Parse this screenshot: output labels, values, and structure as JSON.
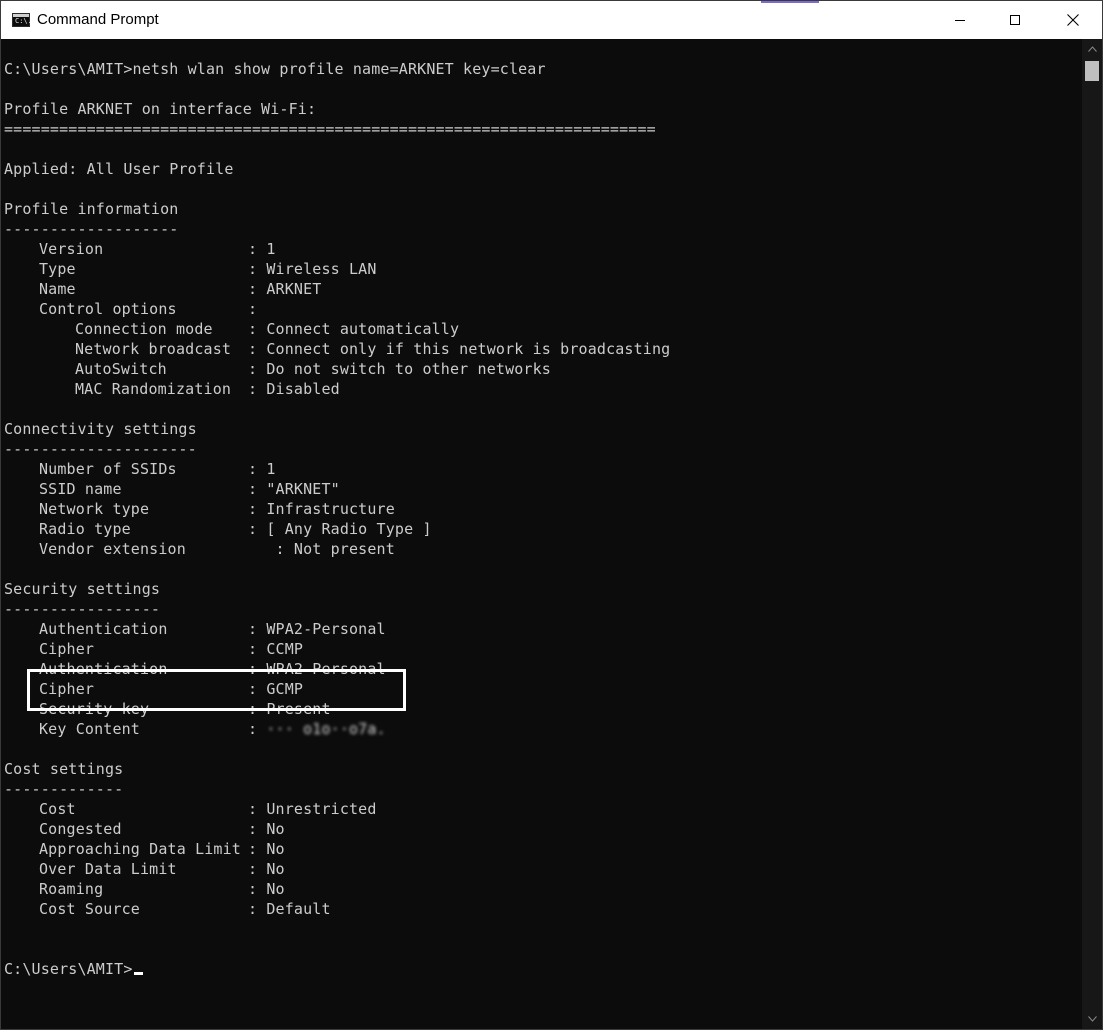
{
  "window": {
    "title": "Command Prompt",
    "icon_text": "C:\\."
  },
  "console": {
    "command_line": "C:\\Users\\AMIT>netsh wlan show profile name=ARKNET key=clear",
    "profile_header": "Profile ARKNET on interface Wi-Fi:",
    "separator": "=======================================================================",
    "applied": "Applied: All User Profile",
    "sections": {
      "profile_info": {
        "title": "Profile information",
        "underline": "-------------------",
        "rows": [
          {
            "label": "Version",
            "sep": ": ",
            "value": "1"
          },
          {
            "label": "Type",
            "sep": ": ",
            "value": "Wireless LAN"
          },
          {
            "label": "Name",
            "sep": ": ",
            "value": "ARKNET"
          },
          {
            "label": "Control options",
            "sep": ":",
            "value": ""
          },
          {
            "label": "Connection mode",
            "sep": ": ",
            "value": "Connect automatically"
          },
          {
            "label": "Network broadcast",
            "sep": ": ",
            "value": "Connect only if this network is broadcasting"
          },
          {
            "label": "AutoSwitch",
            "sep": ": ",
            "value": "Do not switch to other networks"
          },
          {
            "label": "MAC Randomization",
            "sep": ": ",
            "value": "Disabled"
          }
        ]
      },
      "connectivity": {
        "title": "Connectivity settings",
        "underline": "---------------------",
        "rows": [
          {
            "label": "Number of SSIDs",
            "sep": ": ",
            "value": "1"
          },
          {
            "label": "SSID name",
            "sep": ": ",
            "value": "\"ARKNET\""
          },
          {
            "label": "Network type",
            "sep": ": ",
            "value": "Infrastructure"
          },
          {
            "label": "Radio type",
            "sep": ": ",
            "value": "[ Any Radio Type ]"
          },
          {
            "label": "Vendor extension",
            "sep": "   : ",
            "value": "Not present"
          }
        ]
      },
      "security": {
        "title": "Security settings",
        "underline": "-----------------",
        "rows": [
          {
            "label": "Authentication",
            "sep": ": ",
            "value": "WPA2-Personal"
          },
          {
            "label": "Cipher",
            "sep": ": ",
            "value": "CCMP"
          },
          {
            "label": "Authentication",
            "sep": ": ",
            "value": "WPA2-Personal"
          },
          {
            "label": "Cipher",
            "sep": ": ",
            "value": "GCMP"
          },
          {
            "label": "Security key",
            "sep": ": ",
            "value": "Present"
          },
          {
            "label": "Key Content",
            "sep": ": ",
            "value": "··· o1o··o7a."
          }
        ]
      },
      "cost": {
        "title": "Cost settings",
        "underline": "-------------",
        "rows": [
          {
            "label": "Cost",
            "sep": ": ",
            "value": "Unrestricted"
          },
          {
            "label": "Congested",
            "sep": ": ",
            "value": "No"
          },
          {
            "label": "Approaching Data Limit",
            "sep": ": ",
            "value": "No"
          },
          {
            "label": "Over Data Limit",
            "sep": ": ",
            "value": "No"
          },
          {
            "label": "Roaming",
            "sep": ": ",
            "value": "No"
          },
          {
            "label": "Cost Source",
            "sep": ": ",
            "value": "Default"
          }
        ]
      }
    },
    "prompt": "C:\\Users\\AMIT>"
  },
  "colors": {
    "console_bg": "#0c0c0c",
    "console_text": "#cccccc",
    "titlebar_bg": "#ffffff",
    "highlight_border": "#ffffff"
  }
}
